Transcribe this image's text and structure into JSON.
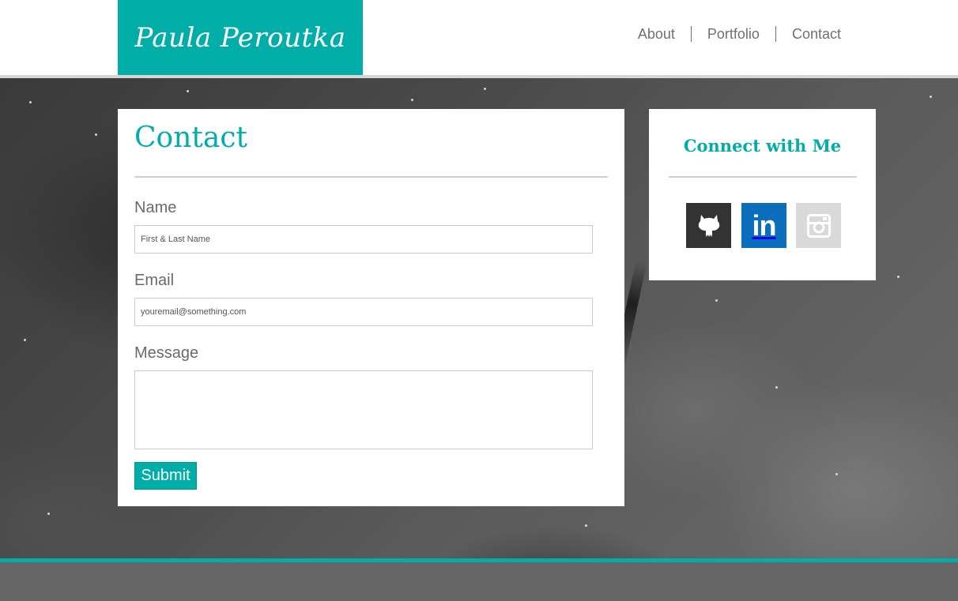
{
  "header": {
    "logo_text": "Paula Peroutka",
    "nav": [
      {
        "label": "About"
      },
      {
        "label": "Portfolio"
      },
      {
        "label": "Contact"
      }
    ]
  },
  "contact": {
    "title": "Contact",
    "fields": {
      "name": {
        "label": "Name",
        "placeholder": "First & Last Name"
      },
      "email": {
        "label": "Email",
        "placeholder": "youremail@something.com"
      },
      "message": {
        "label": "Message"
      }
    },
    "submit_label": "Submit"
  },
  "connect": {
    "title": "Connect with Me",
    "social": [
      {
        "icon": "github-icon",
        "color": "#333333"
      },
      {
        "icon": "linkedin-icon",
        "color": "#0a6ebd",
        "glyph": "in"
      },
      {
        "icon": "instagram-icon",
        "color": "#d9d9d9"
      }
    ]
  },
  "colors": {
    "accent": "#00ada7",
    "footer": "#666666",
    "nav_text": "#707070"
  }
}
